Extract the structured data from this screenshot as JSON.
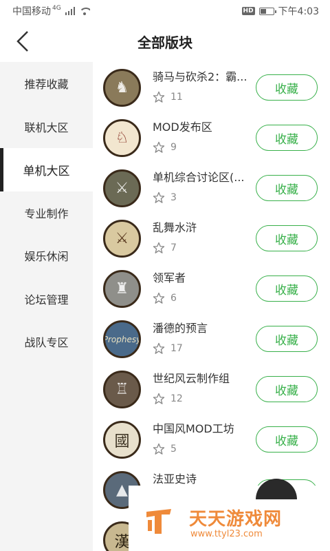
{
  "status_bar": {
    "carrier": "中国移动",
    "network": "4G",
    "hd": "HD",
    "time": "下午4:03"
  },
  "header": {
    "title": "全部版块"
  },
  "sidebar": {
    "items": [
      {
        "label": "推荐收藏"
      },
      {
        "label": "联机大区"
      },
      {
        "label": "单机大区"
      },
      {
        "label": "专业制作"
      },
      {
        "label": "娱乐休闲"
      },
      {
        "label": "论坛管理"
      },
      {
        "label": "战队专区"
      }
    ],
    "active_index": 2
  },
  "boards": [
    {
      "name": "骑马与砍杀2：霸...",
      "count": "11",
      "button": "收藏",
      "color": "#8a7a5a"
    },
    {
      "name": "MOD发布区",
      "count": "9",
      "button": "收藏",
      "color": "#f2e6cf"
    },
    {
      "name": "单机综合讨论区(...",
      "count": "3",
      "button": "收藏",
      "color": "#6b6a55"
    },
    {
      "name": "乱舞水浒",
      "count": "7",
      "button": "收藏",
      "color": "#d9c9a0"
    },
    {
      "name": "领军者",
      "count": "6",
      "button": "收藏",
      "color": "#8f8f8a"
    },
    {
      "name": "潘德的预言",
      "count": "17",
      "button": "收藏",
      "color": "#4a6a8a"
    },
    {
      "name": "世纪风云制作组",
      "count": "12",
      "button": "收藏",
      "color": "#6a5a4a"
    },
    {
      "name": "中国风MOD工坊",
      "count": "5",
      "button": "收藏",
      "color": "#e8e0cc"
    },
    {
      "name": "法亚史诗",
      "count": "",
      "button": "收藏",
      "color": "#5a6a7a"
    },
    {
      "name": "",
      "count": "",
      "button": "",
      "color": "#c8b890"
    }
  ],
  "banner": {
    "title": "天天游戏网",
    "url": "www.ttyl23.com"
  },
  "colors": {
    "accent": "#38b04a",
    "brand": "#ef8a3a"
  }
}
